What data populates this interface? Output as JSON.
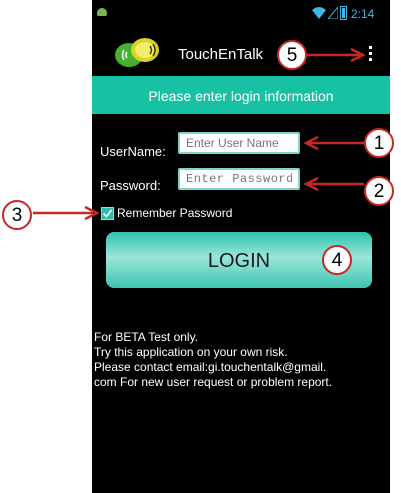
{
  "status_bar": {
    "time": "2:14"
  },
  "app_bar": {
    "title": "TouchEnTalk"
  },
  "banner": {
    "text": "Please enter login information"
  },
  "form": {
    "username_label": "UserName:",
    "username_placeholder": "Enter User Name",
    "password_label": "Password:",
    "password_placeholder": "Enter Password",
    "remember_label": "Remember Password",
    "remember_checked": true,
    "login_label": "LOGIN"
  },
  "notice": [
    "For BETA Test only.",
    "Try this application on your own risk.",
    "Please contact email:gi.touchentalk@gmail.",
    "com For new user request or problem report."
  ],
  "annotations": {
    "callout_1": "1",
    "callout_2": "2",
    "callout_3": "3",
    "callout_4": "4",
    "callout_5": "5",
    "callout_color": "#c62828"
  },
  "colors": {
    "accent": "#18c1a4",
    "status_blue": "#3fb6e5"
  }
}
